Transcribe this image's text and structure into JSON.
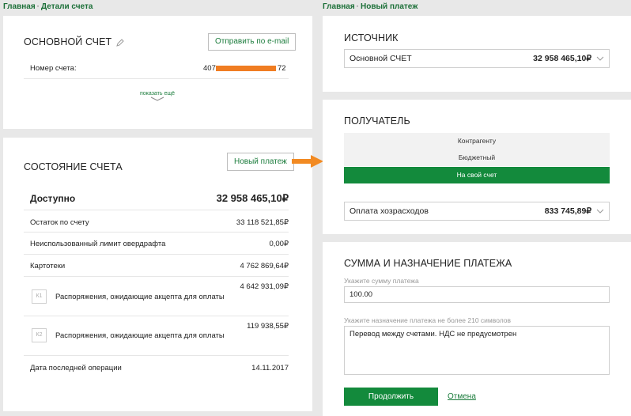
{
  "left": {
    "breadcrumb": {
      "home": "Главная",
      "sep": "·",
      "current": "Детали счета"
    },
    "account": {
      "title": "ОСНОВНОЙ СЧЕТ",
      "email_button": "Отправить по e-mail",
      "number_label": "Номер счета:",
      "number_prefix": "407",
      "number_suffix": "72",
      "show_more": "показать ещё"
    },
    "status": {
      "title": "СОСТОЯНИЕ СЧЕТА",
      "new_payment_button": "Новый платеж",
      "available_label": "Доступно",
      "available_value": "32 958 465,10₽",
      "rows": [
        {
          "label": "Остаток по счету",
          "value": "33 118 521,85₽"
        },
        {
          "label": "Неиспользованный лимит овердрафта",
          "value": "0,00₽"
        },
        {
          "label": "Картотеки",
          "value": "4 762 869,64₽"
        }
      ],
      "pending": [
        {
          "label": "Распоряжения, ожидающие акцепта для оплаты",
          "value": "4 642 931,09₽",
          "badge": "К1"
        },
        {
          "label": "Распоряжения, ожидающие акцепта для оплаты",
          "value": "119 938,55₽",
          "badge": "К2"
        }
      ],
      "last_op_label": "Дата последней операции",
      "last_op_value": "14.11.2017"
    }
  },
  "right": {
    "breadcrumb": {
      "home": "Главная",
      "sep": "·",
      "current": "Новый платеж"
    },
    "source": {
      "title": "ИСТОЧНИК",
      "account_name": "Основной СЧЕТ",
      "account_balance": "32 958 465,10₽"
    },
    "recipient": {
      "title": "ПОЛУЧАТЕЛЬ",
      "options": [
        "Контрагенту",
        "Бюджетный",
        "На свой счет"
      ],
      "selected_index": 2,
      "account_name": "Оплата хозрасходов",
      "account_balance": "833 745,89₽"
    },
    "amount": {
      "title": "СУММА И НАЗНАЧЕНИЕ ПЛАТЕЖА",
      "amount_label": "Укажите сумму платежа",
      "amount_value": "100.00",
      "purpose_label": "Укажите назначение платежа не более 210 символов",
      "purpose_value": "Перевод между счетами. НДС не предусмотрен",
      "continue_button": "Продолжить",
      "cancel_link": "Отмена"
    }
  },
  "colors": {
    "accent": "#138a3c",
    "arrow": "#f28a22",
    "bar": "#f07d22"
  }
}
